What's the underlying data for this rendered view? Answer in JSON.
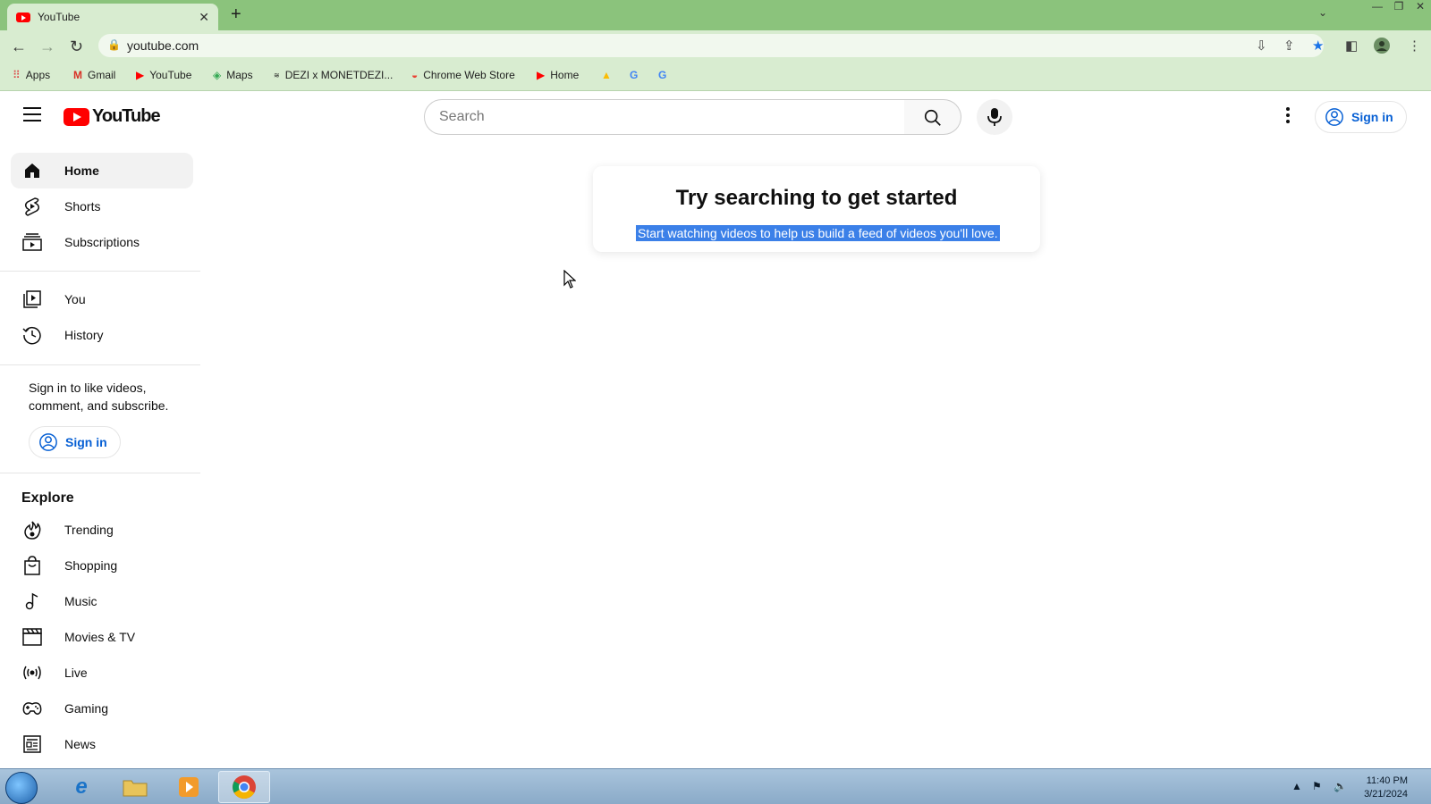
{
  "browser": {
    "tab_title": "YouTube",
    "url": "youtube.com",
    "bookmarks": [
      {
        "label": "Apps",
        "icon": "apps-grid-icon"
      },
      {
        "label": "Gmail",
        "icon": "gmail-icon"
      },
      {
        "label": "YouTube",
        "icon": "youtube-icon"
      },
      {
        "label": "Maps",
        "icon": "maps-icon"
      },
      {
        "label": "DEZI x MONETDEZI...",
        "icon": "dezi-icon"
      },
      {
        "label": "Chrome Web Store",
        "icon": "webstore-icon"
      },
      {
        "label": "Home",
        "icon": "youtube-icon"
      },
      {
        "label": "",
        "icon": "drive-icon"
      },
      {
        "label": "",
        "icon": "google-icon"
      },
      {
        "label": "",
        "icon": "google-icon"
      }
    ]
  },
  "header": {
    "logo_text": "YouTube",
    "search_placeholder": "Search",
    "signin_label": "Sign in"
  },
  "sidebar": {
    "primary": [
      {
        "label": "Home",
        "icon": "home-icon",
        "active": true
      },
      {
        "label": "Shorts",
        "icon": "shorts-icon"
      },
      {
        "label": "Subscriptions",
        "icon": "subscriptions-icon"
      }
    ],
    "secondary": [
      {
        "label": "You",
        "icon": "you-library-icon"
      },
      {
        "label": "History",
        "icon": "history-icon"
      }
    ],
    "signin_prompt": "Sign in to like videos, comment, and subscribe.",
    "signin_label": "Sign in",
    "explore_title": "Explore",
    "explore": [
      {
        "label": "Trending",
        "icon": "trending-icon"
      },
      {
        "label": "Shopping",
        "icon": "shopping-bag-icon"
      },
      {
        "label": "Music",
        "icon": "music-note-icon"
      },
      {
        "label": "Movies & TV",
        "icon": "clapperboard-icon"
      },
      {
        "label": "Live",
        "icon": "live-icon"
      },
      {
        "label": "Gaming",
        "icon": "gamepad-icon"
      },
      {
        "label": "News",
        "icon": "news-icon"
      }
    ]
  },
  "main": {
    "empty_title": "Try searching to get started",
    "empty_subtitle": "Start watching videos to help us build a feed of videos you'll love."
  },
  "taskbar": {
    "time": "11:40 PM",
    "date": "3/21/2024"
  },
  "colors": {
    "chrome_frame": "#8bc37c",
    "chrome_toolbar": "#d8ecd0",
    "youtube_red": "#ff0000",
    "link_blue": "#065fd4",
    "selection_blue": "#3b80e8"
  }
}
